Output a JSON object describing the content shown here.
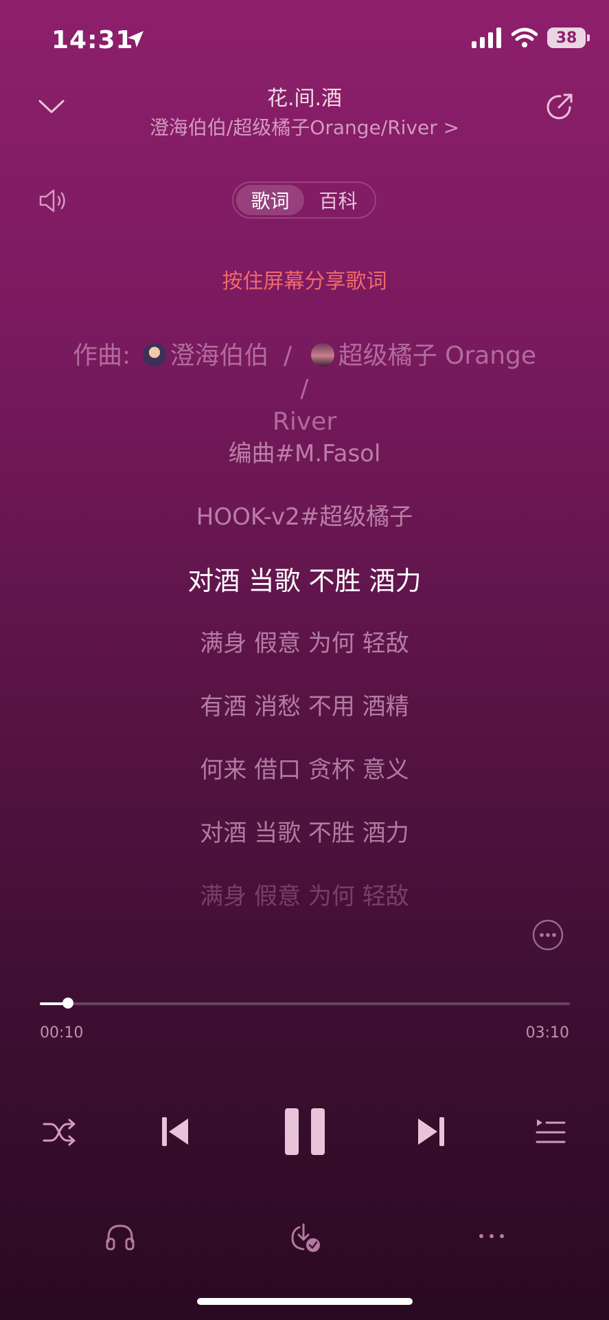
{
  "status": {
    "time": "14:31",
    "battery": "38"
  },
  "header": {
    "title": "花.间.酒",
    "artist": "澄海伯伯/超级橘子Orange/River >"
  },
  "tabs": [
    {
      "label": "歌词",
      "active": true
    },
    {
      "label": "百科",
      "active": false
    }
  ],
  "share_hint": "按住屏幕分享歌词",
  "composer": {
    "prefix": "作曲:",
    "names": [
      "澄海伯伯",
      "超级橘子 Orange",
      "River"
    ],
    "sep": "/"
  },
  "lyrics": [
    {
      "text": "编曲#M.Fasol",
      "current": false
    },
    {
      "text": "HOOK-v2#超级橘子",
      "current": false
    },
    {
      "text": "对酒 当歌 不胜 酒力",
      "current": true
    },
    {
      "text": "满身 假意 为何 轻敌",
      "current": false
    },
    {
      "text": "有酒 消愁 不用 酒精",
      "current": false
    },
    {
      "text": "何来 借口 贪杯 意义",
      "current": false
    },
    {
      "text": "对酒 当歌 不胜 酒力",
      "current": false
    },
    {
      "text": "满身 假意 为何 轻敌",
      "current": false
    }
  ],
  "playback": {
    "elapsed": "00:10",
    "total": "03:10",
    "progress": 0.0526
  },
  "icons": {
    "collapse": "chevron-down-icon",
    "share": "share-icon",
    "volume": "speaker-icon",
    "more_lyrics": "more-circle-icon",
    "shuffle": "shuffle-icon",
    "prev": "skip-back-icon",
    "pause": "pause-icon",
    "next": "skip-forward-icon",
    "playlist": "playlist-icon",
    "headphones": "headphones-icon",
    "download": "download-done-icon",
    "more": "more-dots-icon"
  },
  "colors": {
    "accent": "#f06a6a",
    "bg_top": "#8e1f6c",
    "bg_bottom": "#2a0a22"
  }
}
